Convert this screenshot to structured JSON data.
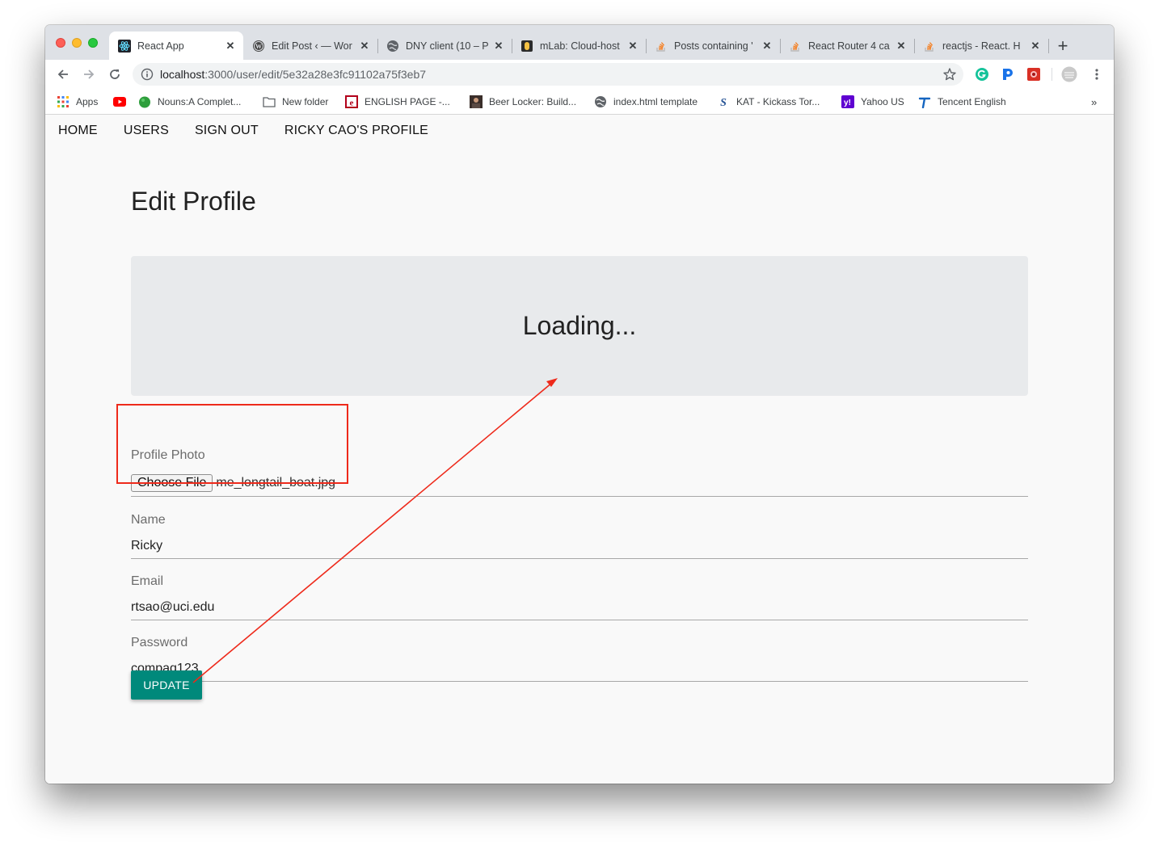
{
  "browser": {
    "tabs": [
      {
        "title": "React App",
        "icon": "react-icon",
        "active": true
      },
      {
        "title": "Edit Post ‹ — Wor",
        "icon": "wordpress-icon",
        "active": false
      },
      {
        "title": "DNY client (10 – P",
        "icon": "globe-icon",
        "active": false
      },
      {
        "title": "mLab: Cloud-host",
        "icon": "mlab-icon",
        "active": false
      },
      {
        "title": "Posts containing '",
        "icon": "stackoverflow-icon",
        "active": false
      },
      {
        "title": "React Router 4 ca",
        "icon": "stackoverflow-icon",
        "active": false
      },
      {
        "title": "reactjs - React. H",
        "icon": "stackoverflow-icon",
        "active": false
      }
    ],
    "address": {
      "host": "localhost",
      "path": ":3000/user/edit/5e32a28e3fc91102a75f3eb7"
    },
    "bookmarks": [
      {
        "label": "Apps",
        "icon": "apps-grid-icon"
      },
      {
        "label": "",
        "icon": "youtube-icon"
      },
      {
        "label": "Nouns:A Complet...",
        "icon": "green-blob-icon"
      },
      {
        "label": "New folder",
        "icon": "folder-icon"
      },
      {
        "label": "ENGLISH PAGE -...",
        "icon": "englishpage-icon"
      },
      {
        "label": "Beer Locker: Build...",
        "icon": "avatar-thumb-icon"
      },
      {
        "label": "index.html template",
        "icon": "globe-icon"
      },
      {
        "label": "KAT - Kickass Tor...",
        "icon": "kat-icon"
      },
      {
        "label": "Yahoo US",
        "icon": "yahoo-icon"
      },
      {
        "label": "Tencent English",
        "icon": "tencent-icon"
      }
    ],
    "bookmarks_overflow": "»",
    "new_tab": "+"
  },
  "nav": {
    "home": "HOME",
    "users": "USERS",
    "sign_out": "SIGN OUT",
    "profile": "RICKY CAO'S PROFILE"
  },
  "page": {
    "title": "Edit Profile",
    "loading": "Loading..."
  },
  "form": {
    "photo": {
      "label": "Profile Photo",
      "button": "Choose File",
      "file": "me_longtail_boat.jpg"
    },
    "name": {
      "label": "Name",
      "value": "Ricky"
    },
    "email": {
      "label": "Email",
      "value": "rtsao@uci.edu"
    },
    "password": {
      "label": "Password",
      "value": "compaq123"
    },
    "submit": "UPDATE"
  },
  "colors": {
    "accent": "#00897b",
    "annotation": "#ee2a1b",
    "jumbotron": "#e8eaec"
  }
}
